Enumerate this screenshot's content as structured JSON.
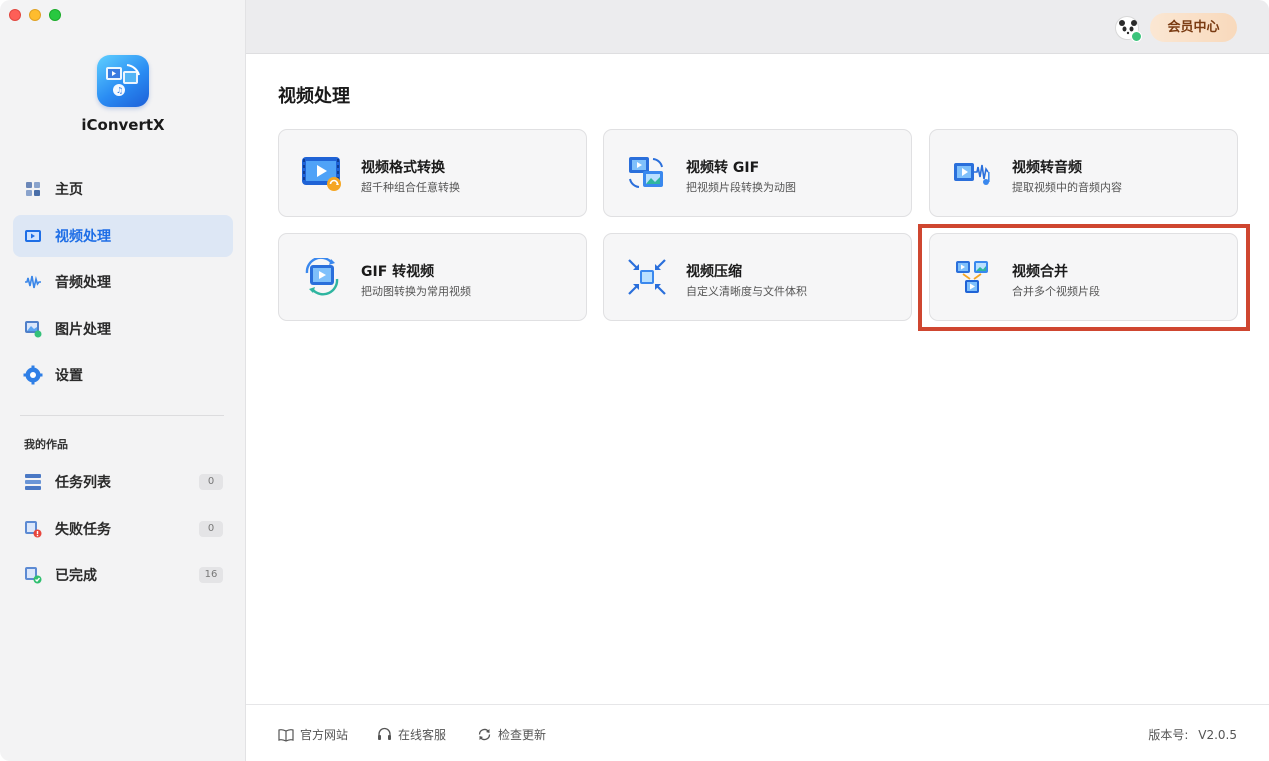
{
  "window": {
    "traffic_lights": [
      "close",
      "minimize",
      "zoom"
    ]
  },
  "app": {
    "name": "iConvertX"
  },
  "sidebar": {
    "items": [
      {
        "label": "主页",
        "icon": "home-icon"
      },
      {
        "label": "视频处理",
        "icon": "video-process-icon",
        "active": true
      },
      {
        "label": "音频处理",
        "icon": "audio-wave-icon"
      },
      {
        "label": "图片处理",
        "icon": "image-process-icon"
      },
      {
        "label": "设置",
        "icon": "gear-icon"
      }
    ],
    "works_title": "我的作品",
    "works": [
      {
        "label": "任务列表",
        "count": "0",
        "icon": "task-list-icon"
      },
      {
        "label": "失败任务",
        "count": "0",
        "icon": "failed-task-icon"
      },
      {
        "label": "已完成",
        "count": "16",
        "icon": "completed-icon"
      }
    ]
  },
  "header": {
    "member_label": "会员中心"
  },
  "main": {
    "title": "视频处理",
    "cards": [
      {
        "title": "视频格式转换",
        "desc": "超千种组合任意转换",
        "icon": "video-convert-icon"
      },
      {
        "title": "视频转 GIF",
        "desc": "把视频片段转换为动图",
        "icon": "video-to-gif-icon"
      },
      {
        "title": "视频转音频",
        "desc": "提取视频中的音频内容",
        "icon": "video-to-audio-icon"
      },
      {
        "title": "GIF 转视频",
        "desc": "把动图转换为常用视频",
        "icon": "gif-to-video-icon"
      },
      {
        "title": "视频压缩",
        "desc": "自定义清晰度与文件体积",
        "icon": "compress-icon"
      },
      {
        "title": "视频合并",
        "desc": "合并多个视频片段",
        "icon": "merge-icon"
      }
    ]
  },
  "footer": {
    "website": "官方网站",
    "support": "在线客服",
    "update": "检查更新",
    "version_label": "版本号:",
    "version": "V2.0.5"
  },
  "colors": {
    "accent": "#1e6ee6",
    "highlight_box": "#cf4630",
    "member_text": "#7a3b12"
  }
}
